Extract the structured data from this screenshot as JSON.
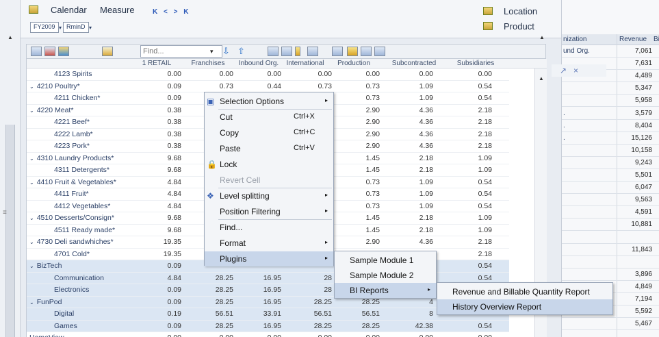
{
  "header": {
    "calendar_label": "Calendar",
    "measure_label": "Measure",
    "nav_arrows": "K < > K",
    "fy_chip": "FY2009",
    "rmind_chip": "RminD",
    "location_label": "Location",
    "product_label": "Product"
  },
  "toolbar": {
    "find_placeholder": "Find..."
  },
  "columns": [
    "1 RETAIL",
    "Franchises",
    "Inbound Org.",
    "International",
    "Production",
    "Subcontracted",
    "Subsidiaries"
  ],
  "rows": [
    {
      "label": "4123 Spirits",
      "indent": 2,
      "caret": "",
      "values": [
        "0.00",
        "0.00",
        "0.00",
        "0.00",
        "0.00",
        "0.00",
        "0.00"
      ],
      "selected": false
    },
    {
      "label": "4210 Poultry*",
      "indent": 1,
      "caret": "⌄",
      "values": [
        "0.09",
        "0.73",
        "0.44",
        "0.73",
        "0.73",
        "1.09",
        "0.54"
      ],
      "selected": false
    },
    {
      "label": "4211 Chicken*",
      "indent": 2,
      "caret": "",
      "values": [
        "0.09",
        "",
        "",
        "73",
        "0.73",
        "1.09",
        "0.54"
      ],
      "selected": false
    },
    {
      "label": "4220 Meat*",
      "indent": 1,
      "caret": "⌄",
      "values": [
        "0.38",
        "",
        "",
        "90",
        "2.90",
        "4.36",
        "2.18"
      ],
      "selected": false
    },
    {
      "label": "4221 Beef*",
      "indent": 2,
      "caret": "",
      "values": [
        "0.38",
        "",
        "",
        "90",
        "2.90",
        "4.36",
        "2.18"
      ],
      "selected": false
    },
    {
      "label": "4222 Lamb*",
      "indent": 2,
      "caret": "",
      "values": [
        "0.38",
        "",
        "",
        "90",
        "2.90",
        "4.36",
        "2.18"
      ],
      "selected": false
    },
    {
      "label": "4223 Pork*",
      "indent": 2,
      "caret": "",
      "values": [
        "0.38",
        "",
        "",
        "90",
        "2.90",
        "4.36",
        "2.18"
      ],
      "selected": false
    },
    {
      "label": "4310 Laundry Products*",
      "indent": 1,
      "caret": "⌄",
      "values": [
        "9.68",
        "",
        "",
        "18",
        "1.45",
        "2.18",
        "1.09"
      ],
      "selected": false
    },
    {
      "label": "4311 Detergents*",
      "indent": 2,
      "caret": "",
      "values": [
        "9.68",
        "",
        "",
        "18",
        "1.45",
        "2.18",
        "1.09"
      ],
      "selected": false
    },
    {
      "label": "4410 Fruit & Vegetables*",
      "indent": 1,
      "caret": "⌄",
      "values": [
        "4.84",
        "",
        "",
        "09",
        "0.73",
        "1.09",
        "0.54"
      ],
      "selected": false
    },
    {
      "label": "4411 Fruit*",
      "indent": 2,
      "caret": "",
      "values": [
        "4.84",
        "",
        "",
        "09",
        "0.73",
        "1.09",
        "0.54"
      ],
      "selected": false
    },
    {
      "label": "4412 Vegetables*",
      "indent": 2,
      "caret": "",
      "values": [
        "4.84",
        "",
        "",
        "09",
        "0.73",
        "1.09",
        "0.54"
      ],
      "selected": false
    },
    {
      "label": "4510 Desserts/Consign*",
      "indent": 1,
      "caret": "⌄",
      "values": [
        "9.68",
        "",
        "",
        "18",
        "1.45",
        "2.18",
        "1.09"
      ],
      "selected": false
    },
    {
      "label": "4511 Ready made*",
      "indent": 2,
      "caret": "",
      "values": [
        "9.68",
        "",
        "",
        "18",
        "1.45",
        "2.18",
        "1.09"
      ],
      "selected": false
    },
    {
      "label": "4730 Deli sandwhiches*",
      "indent": 1,
      "caret": "⌄",
      "values": [
        "19.35",
        "",
        "",
        "37",
        "2.90",
        "4.36",
        "2.18"
      ],
      "selected": false
    },
    {
      "label": "4701 Cold*",
      "indent": 2,
      "caret": "",
      "values": [
        "19.35",
        "",
        "",
        "",
        "",
        "4.36",
        "2.18"
      ],
      "selected": false
    },
    {
      "label": "BizTech",
      "indent": 1,
      "caret": "⌄",
      "values": [
        "0.09",
        "",
        "",
        "",
        "",
        "2.38",
        "0.54"
      ],
      "selected": true
    },
    {
      "label": "Communication",
      "indent": 2,
      "caret": "",
      "values": [
        "4.84",
        "28.25",
        "16.95",
        "28",
        "",
        "2.38",
        "0.54"
      ],
      "selected": true
    },
    {
      "label": "Electronics",
      "indent": 2,
      "caret": "",
      "values": [
        "0.09",
        "28.25",
        "16.95",
        "28",
        "",
        "",
        ""
      ],
      "selected": true
    },
    {
      "label": "FunPod",
      "indent": 1,
      "caret": "⌄",
      "values": [
        "0.09",
        "28.25",
        "16.95",
        "28.25",
        "28.25",
        "4",
        ""
      ],
      "selected": true
    },
    {
      "label": "Digital",
      "indent": 2,
      "caret": "",
      "values": [
        "0.19",
        "56.51",
        "33.91",
        "56.51",
        "56.51",
        "8",
        ""
      ],
      "selected": true
    },
    {
      "label": "Games",
      "indent": 2,
      "caret": "",
      "values": [
        "0.09",
        "28.25",
        "16.95",
        "28.25",
        "28.25",
        "42.38",
        "0.54"
      ],
      "selected": true
    },
    {
      "label": "HomeView",
      "indent": 1,
      "caret": "",
      "values": [
        "0.00",
        "0.00",
        "0.00",
        "0.00",
        "0.00",
        "0.00",
        "0.00"
      ],
      "selected": false
    }
  ],
  "context_menu": {
    "items": [
      {
        "label": "Selection Options",
        "shortcut": "",
        "submenu": true,
        "disabled": false,
        "highlight": false,
        "icon": "selection-icon"
      },
      {
        "label": "Cut",
        "shortcut": "Ctrl+X",
        "submenu": false,
        "disabled": false,
        "highlight": false,
        "icon": ""
      },
      {
        "label": "Copy",
        "shortcut": "Ctrl+C",
        "submenu": false,
        "disabled": false,
        "highlight": false,
        "icon": ""
      },
      {
        "label": "Paste",
        "shortcut": "Ctrl+V",
        "submenu": false,
        "disabled": false,
        "highlight": false,
        "icon": ""
      },
      {
        "label": "Lock",
        "shortcut": "",
        "submenu": false,
        "disabled": false,
        "highlight": false,
        "icon": "lock-icon"
      },
      {
        "label": "Revert Cell",
        "shortcut": "",
        "submenu": false,
        "disabled": true,
        "highlight": false,
        "icon": ""
      },
      {
        "label": "Level splitting",
        "shortcut": "",
        "submenu": true,
        "disabled": false,
        "highlight": false,
        "icon": "level-split-icon"
      },
      {
        "label": "Position Filtering",
        "shortcut": "",
        "submenu": true,
        "disabled": false,
        "highlight": false,
        "icon": ""
      },
      {
        "label": "Find...",
        "shortcut": "",
        "submenu": false,
        "disabled": false,
        "highlight": false,
        "icon": ""
      },
      {
        "label": "Format",
        "shortcut": "",
        "submenu": true,
        "disabled": false,
        "highlight": false,
        "icon": ""
      },
      {
        "label": "Plugins",
        "shortcut": "",
        "submenu": true,
        "disabled": false,
        "highlight": true,
        "icon": ""
      }
    ]
  },
  "plugins_submenu": {
    "items": [
      {
        "label": "Sample Module 1",
        "submenu": false,
        "highlight": false
      },
      {
        "label": "Sample Module 2",
        "submenu": false,
        "highlight": false
      },
      {
        "label": "BI Reports",
        "submenu": true,
        "highlight": true
      }
    ]
  },
  "bi_reports_submenu": {
    "items": [
      {
        "label": "Revenue and Billable Quantity Report",
        "highlight": false
      },
      {
        "label": "History Overview Report",
        "highlight": true
      }
    ]
  },
  "right_panel": {
    "col_org": "nization",
    "col_revenue": "Revenue",
    "col_extra": "Bi",
    "rows": [
      {
        "name": "und Org.",
        "revenue": "7,061"
      },
      {
        "name": "",
        "revenue": "7,631"
      },
      {
        "name": "",
        "revenue": "4,489"
      },
      {
        "name": "",
        "revenue": "5,347"
      },
      {
        "name": "",
        "revenue": "5,958"
      },
      {
        "name": ".",
        "revenue": "3,579"
      },
      {
        "name": ".",
        "revenue": "8,404"
      },
      {
        "name": ".",
        "revenue": "15,126"
      },
      {
        "name": "",
        "revenue": "10,158"
      },
      {
        "name": "",
        "revenue": "9,243"
      },
      {
        "name": "",
        "revenue": "5,501"
      },
      {
        "name": "",
        "revenue": "6,047"
      },
      {
        "name": "",
        "revenue": "9,563"
      },
      {
        "name": "",
        "revenue": "4,591"
      },
      {
        "name": "",
        "revenue": "10,881"
      },
      {
        "name": "",
        "revenue": ""
      },
      {
        "name": "",
        "revenue": "11,843"
      },
      {
        "name": "",
        "revenue": ""
      },
      {
        "name": "",
        "revenue": "3,896"
      },
      {
        "name": "",
        "revenue": "4,849"
      },
      {
        "name": "",
        "revenue": "7,194"
      },
      {
        "name": "",
        "revenue": "5,592"
      },
      {
        "name": "",
        "revenue": "5,467"
      }
    ]
  },
  "mini_dialog": {
    "pin": "↗",
    "close": "×"
  }
}
